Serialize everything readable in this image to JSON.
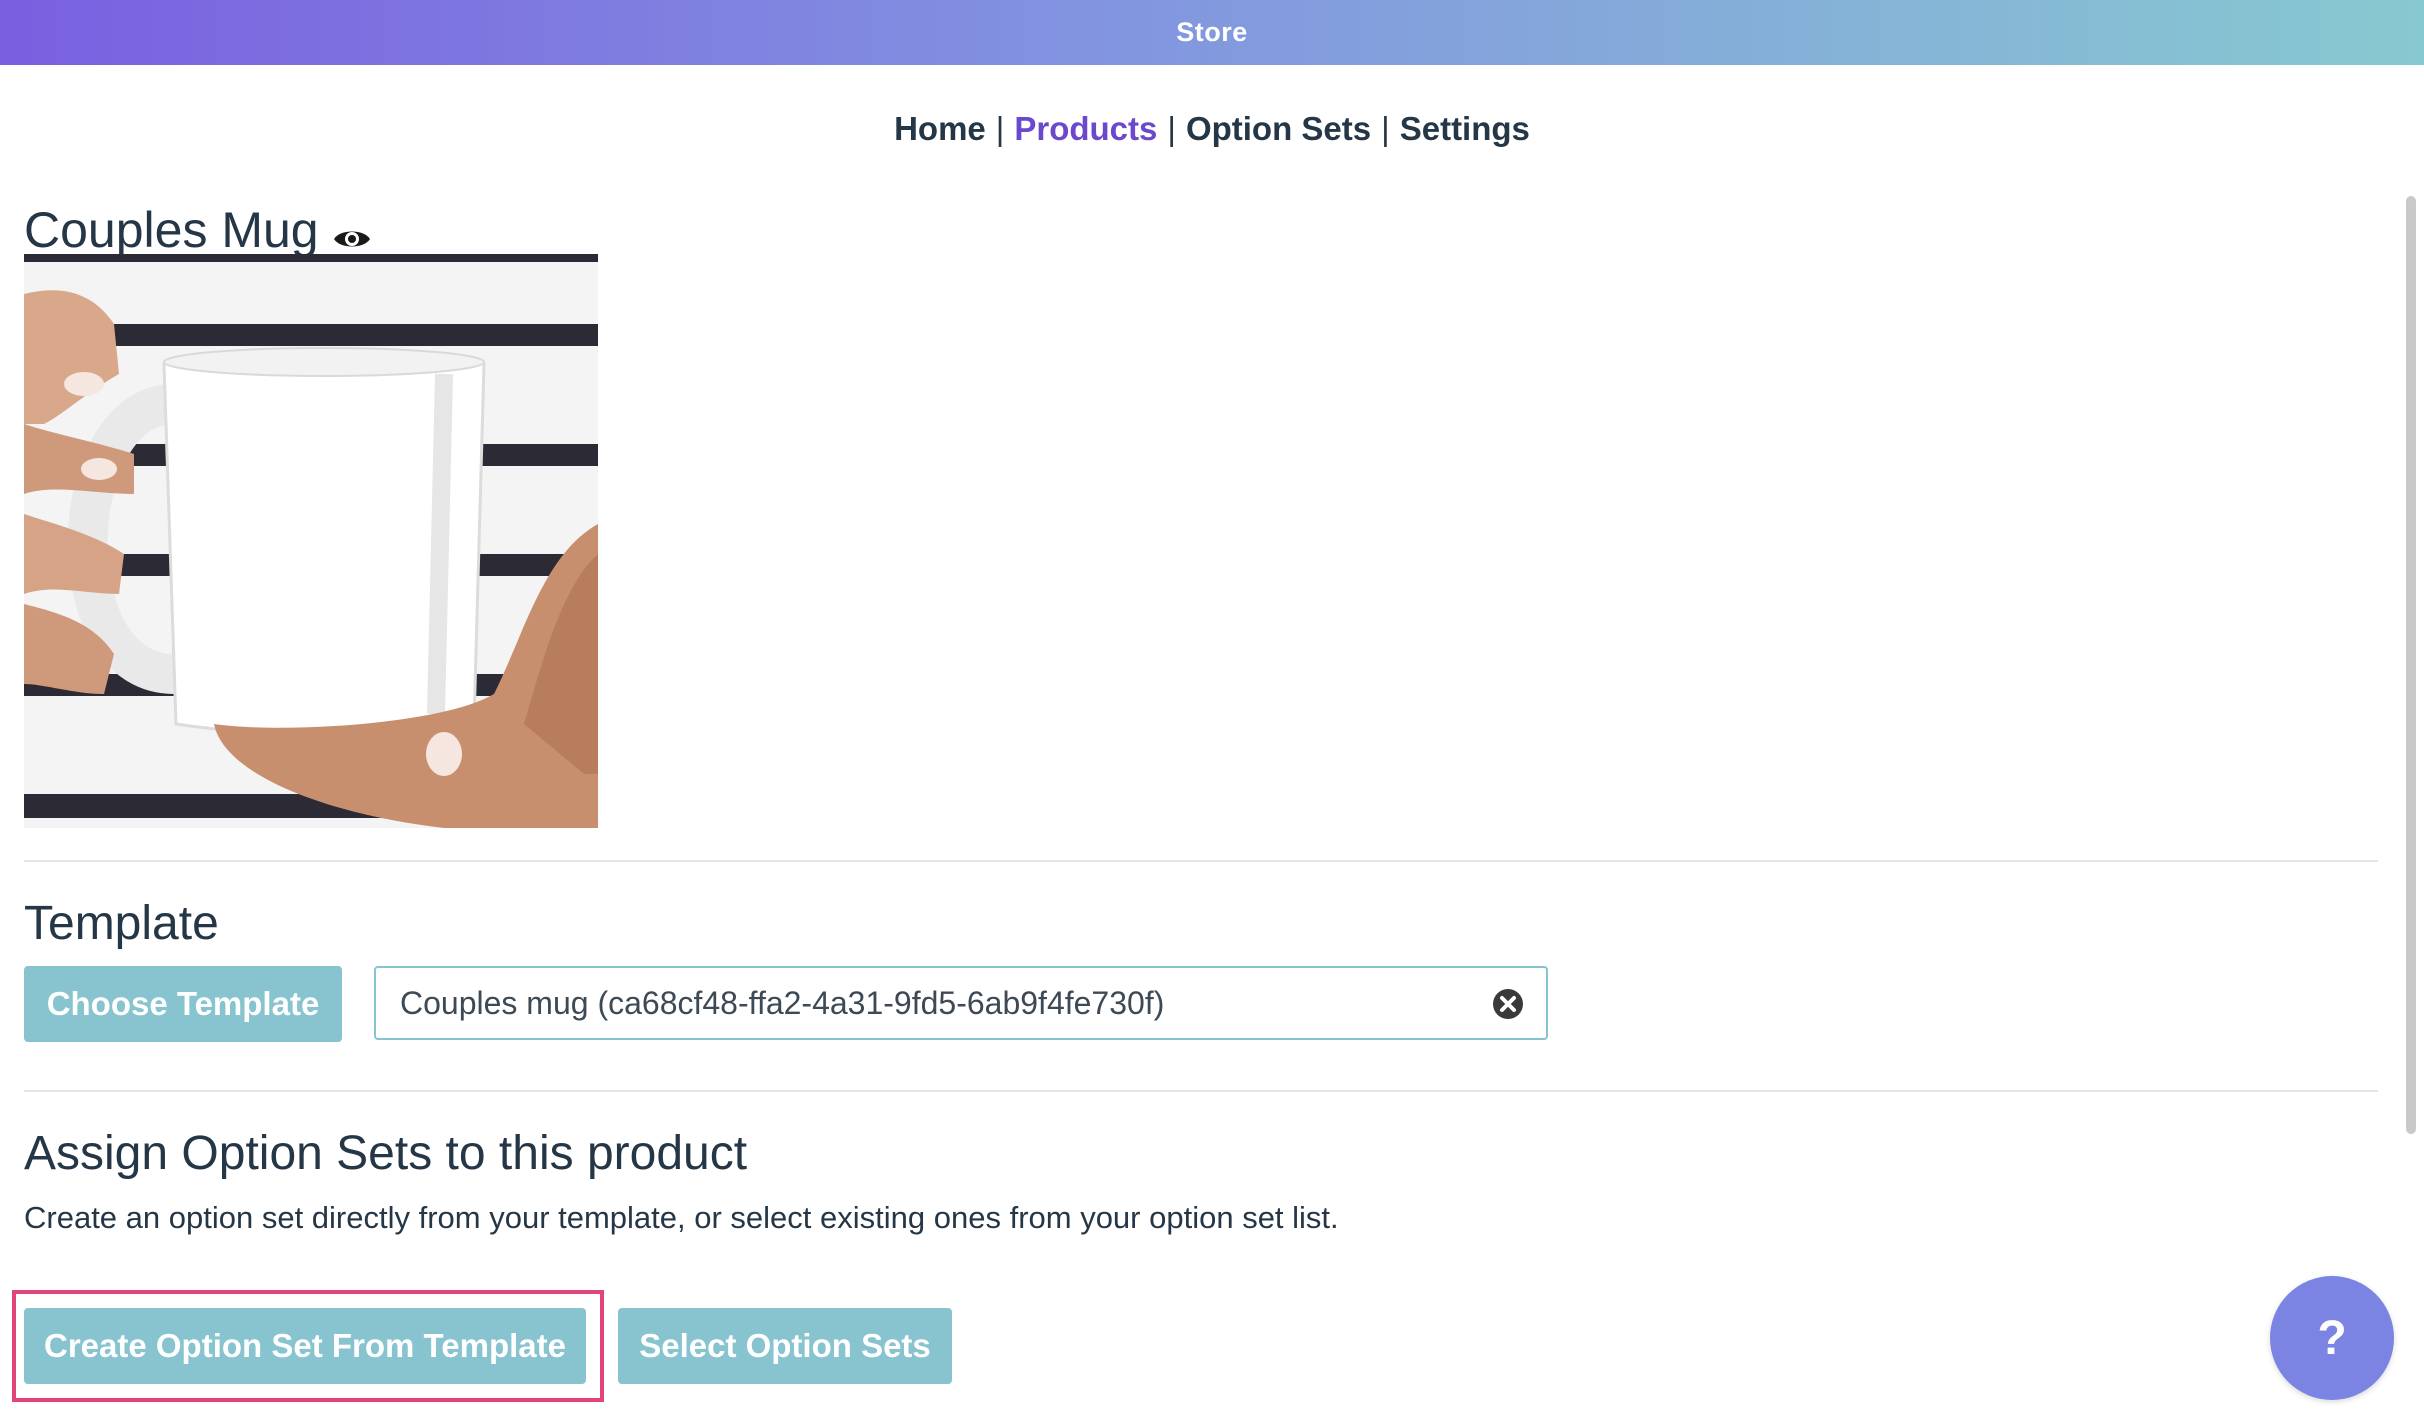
{
  "app": {
    "title": "Store"
  },
  "nav": {
    "items": [
      {
        "label": "Home",
        "active": false
      },
      {
        "label": "Products",
        "active": true
      },
      {
        "label": "Option Sets",
        "active": false
      },
      {
        "label": "Settings",
        "active": false
      }
    ],
    "separator": "|"
  },
  "product": {
    "title": "Couples Mug",
    "preview_icon": "eye-icon",
    "image": "white mug held in two hands"
  },
  "template_section": {
    "title": "Template",
    "choose_button": "Choose Template",
    "selected_value": "Couples mug (ca68cf48-ffa2-4a31-9fd5-6ab9f4fe730f)",
    "clear_icon": "close-circle-icon"
  },
  "option_sets_section": {
    "title": "Assign Option Sets to this product",
    "description": "Create an option set directly from your template, or select existing ones from your option set list.",
    "create_button": "Create Option Set From Template",
    "select_button": "Select Option Sets"
  },
  "help": {
    "label": "?"
  },
  "colors": {
    "accent": "#87c4cf",
    "active_link": "#6b48cc",
    "highlight": "#e0457e",
    "help_button": "#7b83e3",
    "text": "#253746"
  }
}
